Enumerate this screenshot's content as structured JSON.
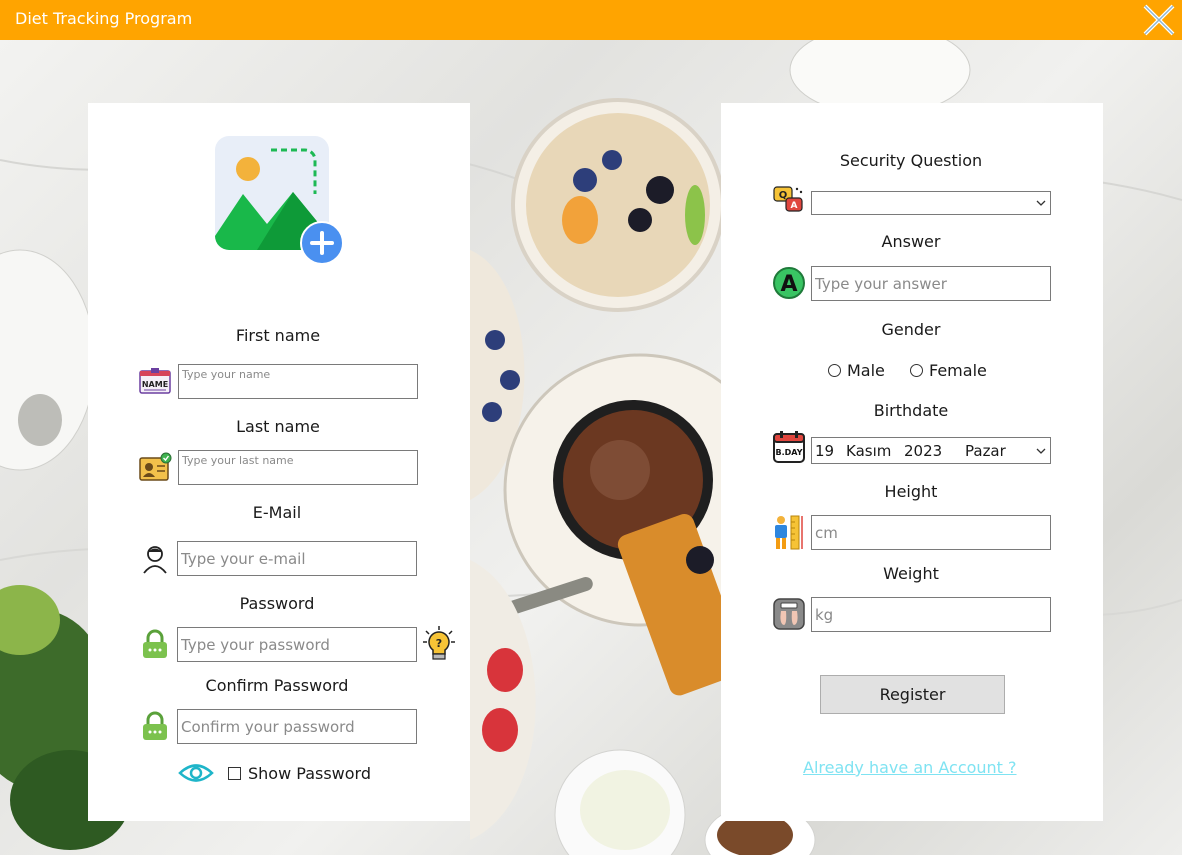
{
  "window": {
    "title": "Diet Tracking Program",
    "close_icon": "close-x-icon",
    "accent": "#ffa400"
  },
  "left": {
    "avatar_icon": "add-image-icon",
    "first_name": {
      "label": "First name",
      "placeholder": "Type your name",
      "icon": "name-tag-icon"
    },
    "last_name": {
      "label": "Last name",
      "placeholder": "Type your last name",
      "icon": "id-card-icon"
    },
    "email": {
      "label": "E-Mail",
      "placeholder": "Type your e-mail",
      "icon": "user-icon"
    },
    "password": {
      "label": "Password",
      "placeholder": "Type your password",
      "icon": "lock-icon",
      "hint_icon": "lightbulb-question-icon"
    },
    "confirm_password": {
      "label": "Confirm Password",
      "placeholder": "Confirm your password",
      "icon": "lock-icon"
    },
    "show_password": {
      "label": "Show Password",
      "icon": "eye-icon",
      "checked": false
    }
  },
  "right": {
    "security_question": {
      "label": "Security Question",
      "value": "",
      "icon": "question-bubbles-icon"
    },
    "answer": {
      "label": "Answer",
      "placeholder": "Type your answer",
      "icon": "letter-a-icon"
    },
    "gender": {
      "label": "Gender",
      "options": [
        "Male",
        "Female"
      ],
      "selected": null
    },
    "birthdate": {
      "label": "Birthdate",
      "day": "19",
      "month": "Kasım",
      "year": "2023",
      "weekday": "Pazar",
      "icon": "birthday-calendar-icon"
    },
    "height": {
      "label": "Height",
      "placeholder": "cm",
      "icon": "height-measure-icon"
    },
    "weight": {
      "label": "Weight",
      "placeholder": "kg",
      "icon": "scale-icon"
    },
    "register_label": "Register",
    "login_link": "Already have an Account ?",
    "link_color": "#7fe3f2"
  }
}
